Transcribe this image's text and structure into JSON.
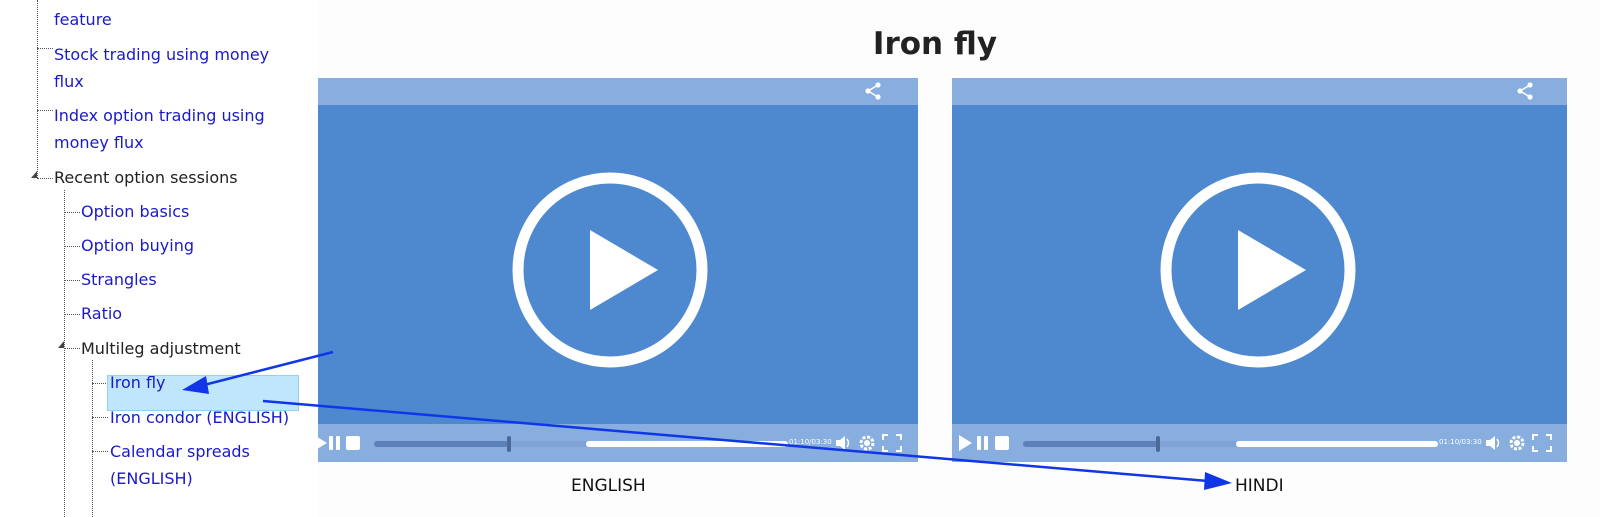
{
  "sidebar": {
    "items": [
      {
        "label": "feature",
        "kind": "link"
      },
      {
        "label": "Stock trading using money",
        "kind": "link"
      },
      {
        "label": "flux",
        "kind": "link"
      },
      {
        "label": "Index option trading using",
        "kind": "link"
      },
      {
        "label": "money flux",
        "kind": "link"
      },
      {
        "label": "Recent option sessions",
        "kind": "folder"
      },
      {
        "label": "Option basics",
        "kind": "link"
      },
      {
        "label": "Option buying",
        "kind": "link"
      },
      {
        "label": "Strangles",
        "kind": "link"
      },
      {
        "label": "Ratio",
        "kind": "link"
      },
      {
        "label": "Multileg adjustment",
        "kind": "folder"
      },
      {
        "label": "Iron fly",
        "kind": "link",
        "selected": true
      },
      {
        "label": "Iron condor (ENGLISH)",
        "kind": "link"
      },
      {
        "label": "Calendar spreads",
        "kind": "link"
      },
      {
        "label": "(ENGLISH)",
        "kind": "link"
      }
    ]
  },
  "main": {
    "title": "Iron fly",
    "videos": [
      {
        "caption": "ENGLISH",
        "time": "01:10/03:30",
        "progress": 0.33
      },
      {
        "caption": "HINDI",
        "time": "01:10/03:30",
        "progress": 0.33
      }
    ]
  },
  "colors": {
    "video_bg": "#4e89d0",
    "video_bar": "#88aedf",
    "link": "#1a1ac8",
    "selected_bg": "#bfe6fb",
    "annotation_arrow": "#1036e8"
  },
  "icons": [
    "share-icon",
    "play-icon",
    "pause-icon",
    "stop-icon",
    "volume-icon",
    "settings-icon",
    "fullscreen-icon",
    "tree-toggle-icon"
  ]
}
